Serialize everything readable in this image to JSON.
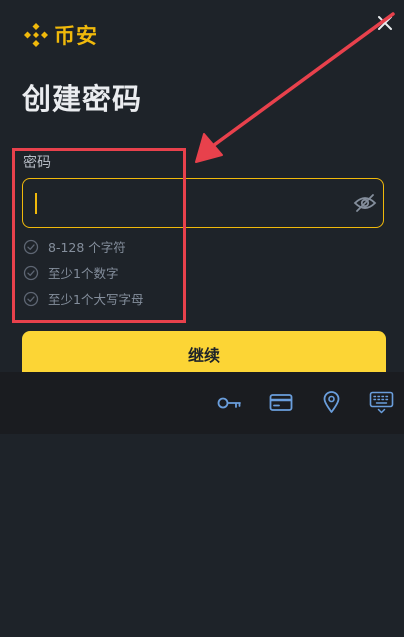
{
  "brand": {
    "name": "币安",
    "color": "#f0b90b",
    "icon": "binance-logo-icon"
  },
  "page": {
    "title": "创建密码"
  },
  "password": {
    "label": "密码",
    "value": "",
    "visibility_icon": "eye-off-icon"
  },
  "rules": [
    {
      "text": "8-128 个字符",
      "icon": "check-circle-icon"
    },
    {
      "text": "至少1个数字",
      "icon": "check-circle-icon"
    },
    {
      "text": "至少1个大写字母",
      "icon": "check-circle-icon"
    }
  ],
  "continue_button": {
    "label": "继续",
    "color": "#fcd535"
  },
  "keyboard_toolbar": {
    "icons": [
      "key-icon",
      "credit-card-icon",
      "location-pin-icon",
      "keyboard-icon"
    ],
    "icon_color": "#6a9edc"
  },
  "annotation": {
    "color": "#e8414c"
  }
}
